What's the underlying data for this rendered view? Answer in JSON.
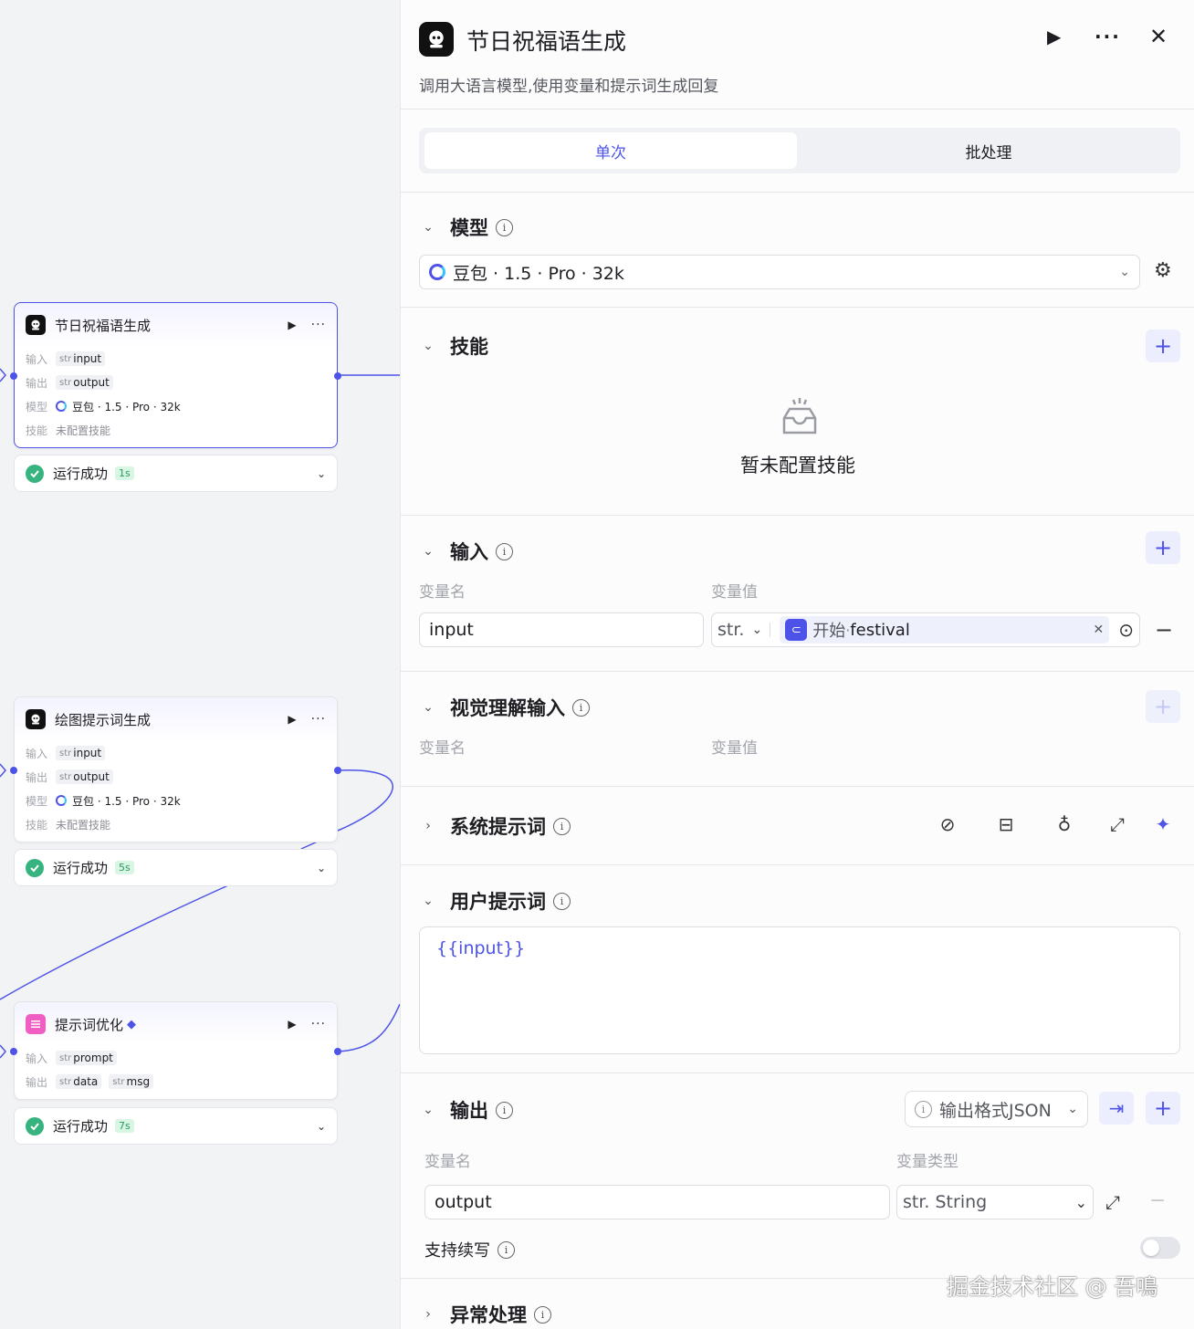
{
  "canvas": {
    "nodes": [
      {
        "title": "节日祝福语生成",
        "input_label": "输入",
        "input_type": "str",
        "input_value": "input",
        "output_label": "输出",
        "output_type": "str",
        "output_value": "output",
        "model_label": "模型",
        "model_value": "豆包 · 1.5 · Pro · 32k",
        "skill_label": "技能",
        "skill_value": "未配置技能",
        "status": "运行成功",
        "time": "1s"
      },
      {
        "title": "绘图提示词生成",
        "input_label": "输入",
        "input_type": "str",
        "input_value": "input",
        "output_label": "输出",
        "output_type": "str",
        "output_value": "output",
        "model_label": "模型",
        "model_value": "豆包 · 1.5 · Pro · 32k",
        "skill_label": "技能",
        "skill_value": "未配置技能",
        "status": "运行成功",
        "time": "5s"
      },
      {
        "title": "提示词优化",
        "input_label": "输入",
        "input_type": "str",
        "input_value": "prompt",
        "output_label": "输出",
        "output_type": "str",
        "output_value": "data",
        "output_value2": "msg",
        "status": "运行成功",
        "time": "7s"
      }
    ]
  },
  "panel": {
    "title": "节日祝福语生成",
    "description": "调用大语言模型,使用变量和提示词生成回复",
    "tabs": [
      "单次",
      "批处理"
    ],
    "model": {
      "title": "模型",
      "value": "豆包 · 1.5 · Pro · 32k"
    },
    "skills": {
      "title": "技能",
      "empty": "暂未配置技能"
    },
    "input": {
      "title": "输入",
      "col_name": "变量名",
      "col_value": "变量值",
      "name": "input",
      "type": "str.",
      "ref_node": "开始",
      "ref_sep": " · ",
      "ref_var": "festival"
    },
    "vision": {
      "title": "视觉理解输入",
      "col_name": "变量名",
      "col_value": "变量值"
    },
    "system_prompt": {
      "title": "系统提示词"
    },
    "user_prompt": {
      "title": "用户提示词",
      "content": "{{input}}"
    },
    "output": {
      "title": "输出",
      "format": "输出格式JSON",
      "col_name": "变量名",
      "col_type": "变量类型",
      "name": "output",
      "type": "str. String",
      "streaming_label": "支持续写"
    },
    "error": {
      "title": "异常处理"
    }
  },
  "watermark": "掘金技术社区 @ 吾鳴",
  "colors": {
    "accent": "#4d53e8",
    "success": "#36b37e"
  }
}
